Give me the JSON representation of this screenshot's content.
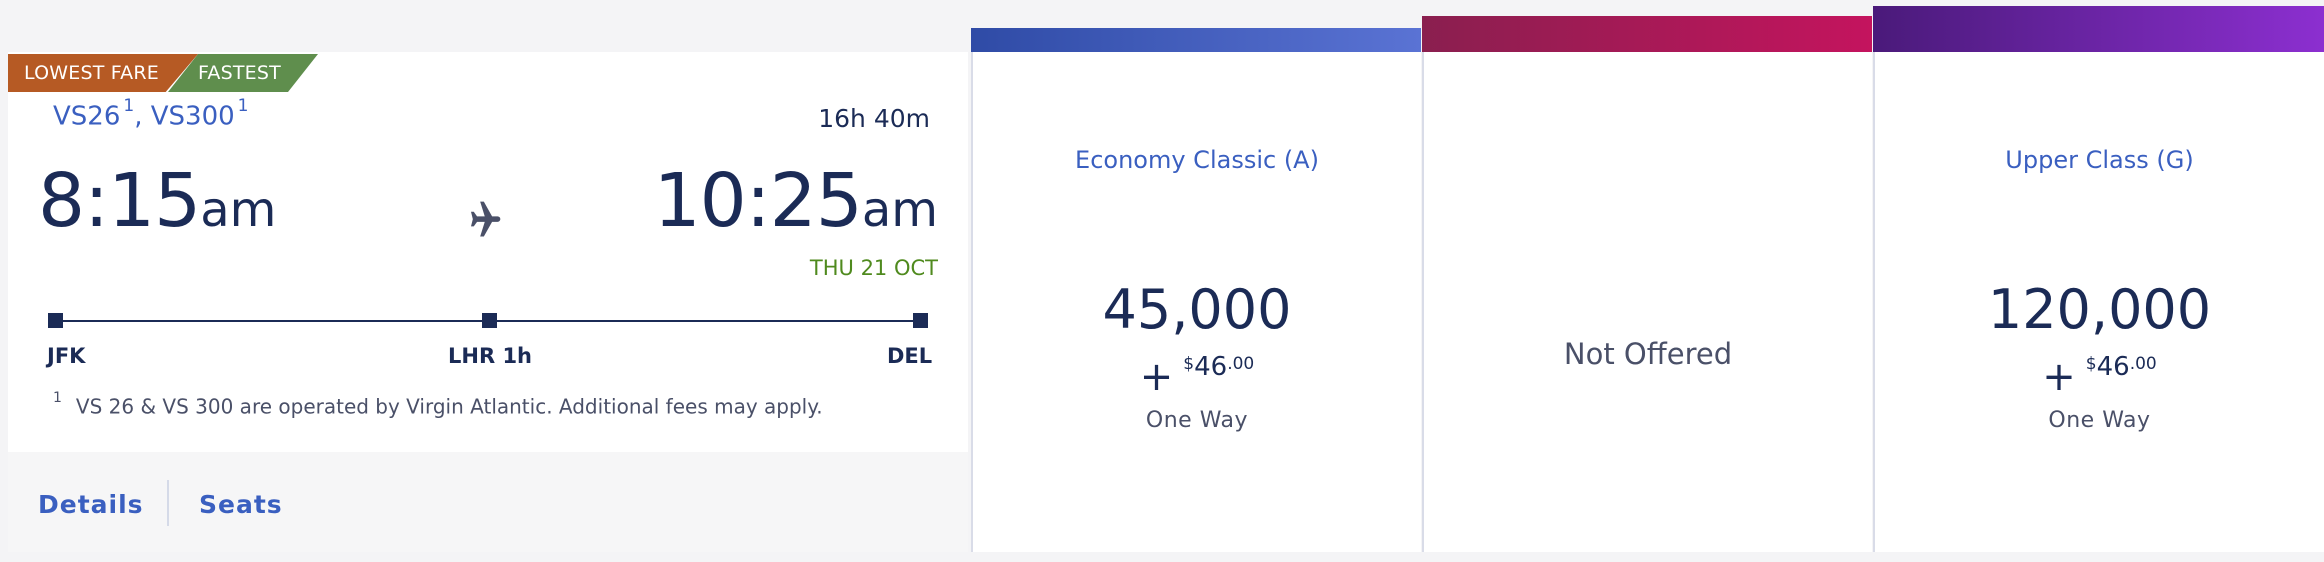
{
  "badges": {
    "lowest": "LOWEST FARE",
    "fastest": "FASTEST"
  },
  "flight": {
    "flight1": "VS26",
    "flight1_note": "1",
    "separator": ",",
    "flight2": "VS300",
    "flight2_note": "1",
    "duration": "16h 40m",
    "depart_time": "8:15",
    "depart_ampm": "am",
    "arrive_time": "10:25",
    "arrive_ampm": "am",
    "arrive_date": "THU 21 OCT",
    "origin": "JFK",
    "stop": "LHR 1h",
    "destination": "DEL",
    "footnote_mark": "1",
    "footnote": "VS 26 & VS 300 are operated by Virgin Atlantic. Additional fees may apply."
  },
  "actions": {
    "details": "Details",
    "seats": "Seats"
  },
  "fares": [
    {
      "title": "Economy Classic (A)",
      "miles": "45,000",
      "plus": "+",
      "currency": "$",
      "dollars": "46",
      "cents": ".00",
      "trip": "One Way",
      "offered": true,
      "colors": [
        "#2f4ba6",
        "#5a73d4"
      ]
    },
    {
      "title": "",
      "not_offered": "Not Offered",
      "offered": false,
      "colors": [
        "#8a1f4f",
        "#c4145e"
      ]
    },
    {
      "title": "Upper Class (G)",
      "miles": "120,000",
      "plus": "+",
      "currency": "$",
      "dollars": "46",
      "cents": ".00",
      "trip": "One Way",
      "offered": true,
      "colors": [
        "#4a1a7a",
        "#8c2fd0"
      ]
    }
  ],
  "colors": {
    "badge_lowest": "#b65a24",
    "badge_fastest": "#5f8e4d",
    "link": "#3a5fc0",
    "navy": "#1b2b56",
    "date_green": "#4f8a1e"
  },
  "icons": {
    "plane": "airplane-icon"
  }
}
